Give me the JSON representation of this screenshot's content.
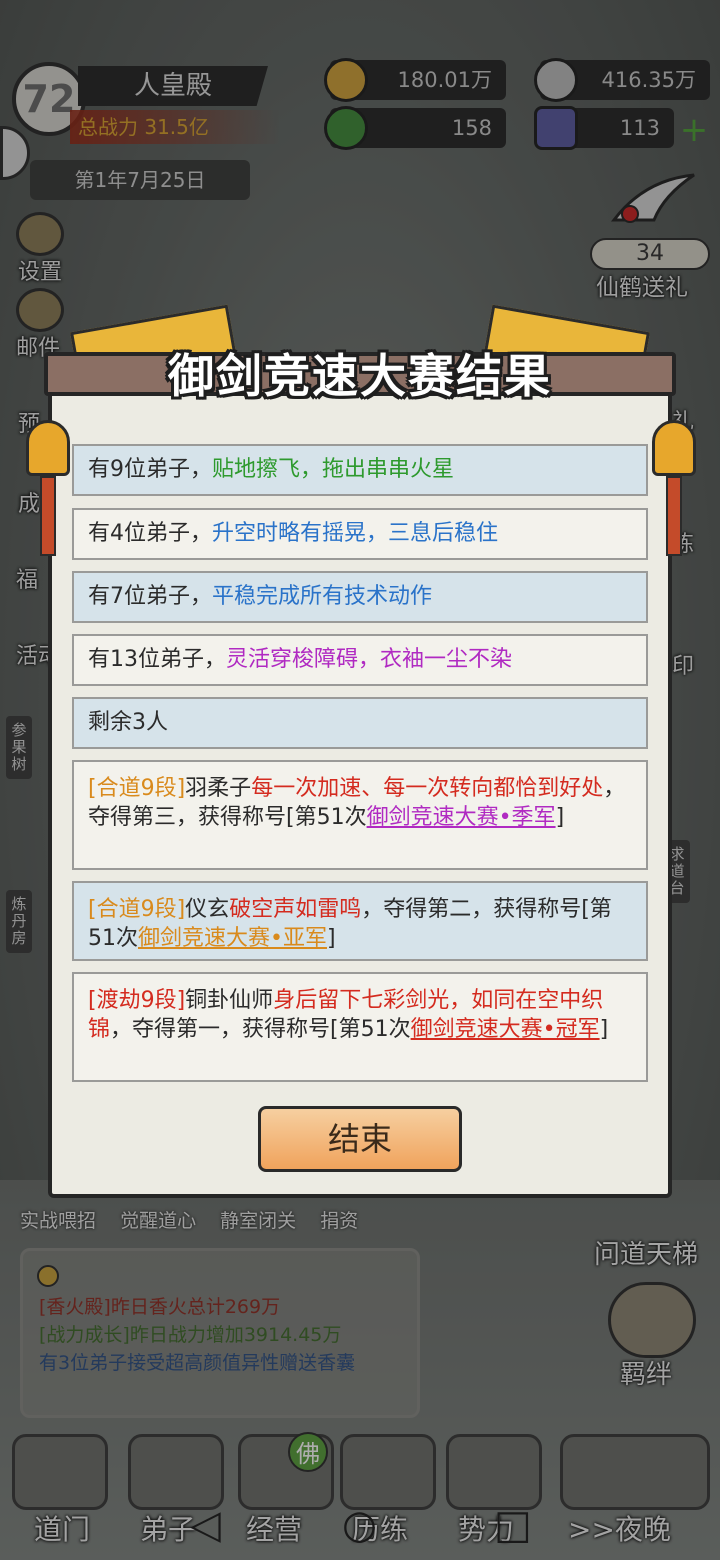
{
  "hud": {
    "level": "72",
    "hall_name": "人皇殿",
    "power_label": "总战力",
    "power_value": "31.5亿",
    "date": "第1年7月25日",
    "resources": {
      "coins": "180.01万",
      "incense": "416.35万",
      "spirit": "158",
      "shield": "113"
    }
  },
  "side_left": {
    "settings": "设置",
    "mail": "邮件",
    "preview_partial": "预",
    "achievement_partial": "成",
    "welfare_partial": "福",
    "activity_partial": "活动",
    "ginseng_tree": "参果树",
    "alchemy_room": "炼丹房"
  },
  "side_right": {
    "crane_count": "34",
    "crane_gift": "仙鹤送礼",
    "gift_partial": "礼",
    "refine_partial": "炼",
    "seal_partial": "印",
    "dao_platform": "求道台"
  },
  "modal": {
    "title": "御剑竞速大赛结果",
    "rows": {
      "r1_prefix": "有9位弟子，",
      "r1_desc": "贴地擦飞，拖出串串火星",
      "r2_prefix": "有4位弟子，",
      "r2_desc": "升空时略有摇晃，三息后稳住",
      "r3_prefix": "有7位弟子，",
      "r3_desc": "平稳完成所有技术动作",
      "r4_prefix": "有13位弟子，",
      "r4_desc": "灵活穿梭障碍，衣袖一尘不染",
      "r5": "剩余3人"
    },
    "third": {
      "rank": "[合道9段]",
      "name": "羽柔子",
      "feat": "每一次加速、每一次转向都恰到好处",
      "result": "，夺得第三，获得称号[第51次",
      "title": "御剑竞速大赛•季军",
      "close": "]"
    },
    "second": {
      "rank": "[合道9段]",
      "name": "仪玄",
      "feat": "破空声如雷鸣",
      "result": "，夺得第二，获得称号[第51次",
      "title": "御剑竞速大赛•亚军",
      "close": "]"
    },
    "first": {
      "rank": "[渡劫9段]",
      "name": "铜卦仙师",
      "feat": "身后留下七彩剑光，如同在空中织锦",
      "result": "，夺得第一，获得称号[第51次",
      "title": "御剑竞速大赛•冠军",
      "close": "]"
    },
    "end_button": "结束"
  },
  "bottom": {
    "actions": [
      "实战喂招",
      "觉醒道心",
      "静室闭关",
      "捐资"
    ],
    "ladder": "问道天梯",
    "bond": "羁绊",
    "news": {
      "line1": "[香火殿]昨日香火总计269万",
      "line2": "[战力成长]昨日战力增加3914.45万",
      "line3": "有3位弟子接受超高颜值异性赠送香囊"
    },
    "nav": [
      "道门",
      "弟子",
      "经营",
      "历练",
      "势力",
      ">>夜晚"
    ],
    "buddha": "佛"
  },
  "colors": {
    "green": "#2e9a2e",
    "blue": "#2a73c9",
    "purple": "#b02ac2",
    "orange": "#d98a1c",
    "red": "#d42b1f"
  }
}
